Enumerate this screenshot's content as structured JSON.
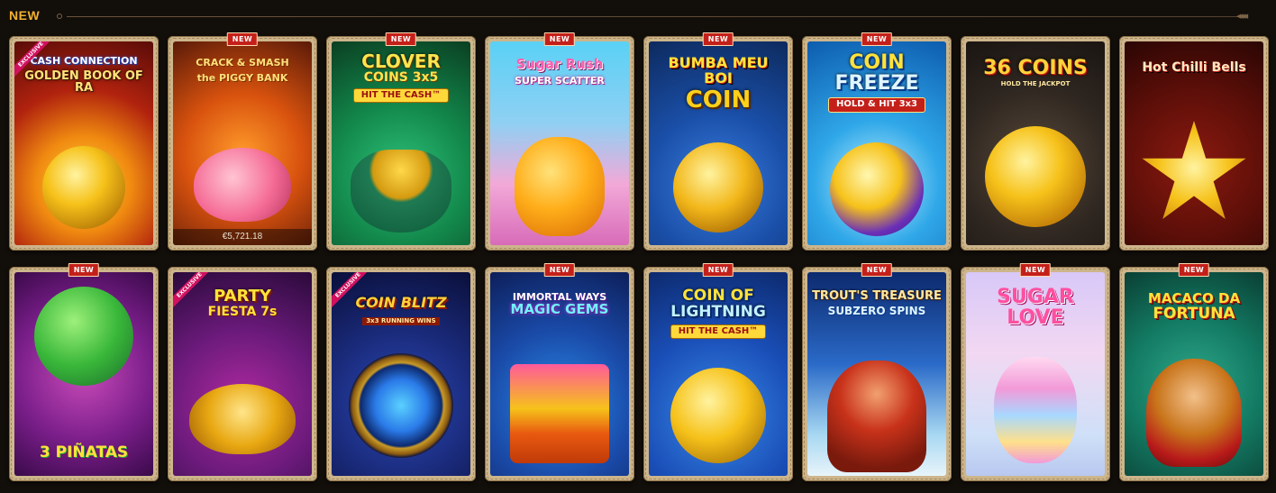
{
  "section": {
    "title": "NEW",
    "arrows": "◂◂◂◂"
  },
  "badges": {
    "new": "NEW",
    "exclusive": "EXCLUSIVE"
  },
  "games": [
    {
      "name": "CASH CONNECTION GOLDEN BOOK OF RA",
      "l1": "CASH CONNECTION",
      "l2": "GOLDEN BOOK OF RA",
      "sub": "",
      "jackpot": "",
      "new": false,
      "exclusive": true
    },
    {
      "name": "CRACK & SMASH THE PIGGY BANK",
      "l1": "CRACK & SMASH",
      "l2": "the PIGGY BANK",
      "sub": "",
      "jackpot": "€5,721.18",
      "new": true,
      "exclusive": false
    },
    {
      "name": "CLOVER COINS 3x5 HIT THE CASH",
      "l1": "CLOVER",
      "l2": "COINS 3x5",
      "sub": "HIT THE CASH™",
      "jackpot": "",
      "new": true,
      "exclusive": false
    },
    {
      "name": "Sugar Rush Super Scatter",
      "l1": "Sugar Rush",
      "l2": "SUPER SCATTER",
      "sub": "",
      "jackpot": "",
      "new": true,
      "exclusive": false
    },
    {
      "name": "BUMBA MEU BOI COIN",
      "l1": "BUMBA MEU BOI",
      "l2": "COIN",
      "sub": "",
      "jackpot": "",
      "new": true,
      "exclusive": false
    },
    {
      "name": "COIN FREEZE HOLD & HIT 3x3",
      "l1": "COIN",
      "l2": "FREEZE",
      "sub": "HOLD & HIT 3x3",
      "jackpot": "",
      "new": true,
      "exclusive": false
    },
    {
      "name": "36 COINS HOLD THE JACKPOT",
      "l1": "36 COINS",
      "l2": "HOLD THE JACKPOT",
      "sub": "",
      "jackpot": "",
      "new": false,
      "exclusive": false
    },
    {
      "name": "Hot Chilli Bells",
      "l1": "Hot Chilli Bells",
      "l2": "",
      "sub": "",
      "jackpot": "",
      "new": false,
      "exclusive": false
    },
    {
      "name": "3 PIÑATAS",
      "l1": "",
      "l2": "3 PIÑATAS",
      "sub": "",
      "jackpot": "",
      "new": true,
      "exclusive": false
    },
    {
      "name": "PARTY FIESTA 7s",
      "l1": "PARTY",
      "l2": "FIESTA 7s",
      "sub": "",
      "jackpot": "",
      "new": false,
      "exclusive": true
    },
    {
      "name": "COIN BLITZ 3x3 RUNNING WINS",
      "l1": "COIN BLITZ",
      "l2": "3x3 RUNNING WINS",
      "sub": "",
      "jackpot": "",
      "new": false,
      "exclusive": true
    },
    {
      "name": "IMMORTAL WAYS MAGIC GEMS",
      "l1": "IMMORTAL WAYS",
      "l2": "MAGIC GEMS",
      "sub": "",
      "jackpot": "",
      "new": true,
      "exclusive": false
    },
    {
      "name": "COIN OF LIGHTNING HIT THE CASH",
      "l1": "COIN OF",
      "l2": "LIGHTNING",
      "sub": "HIT THE CASH™",
      "jackpot": "",
      "new": true,
      "exclusive": false
    },
    {
      "name": "TROUT'S TREASURE SUBZERO SPINS",
      "l1": "TROUT'S TREASURE",
      "l2": "SUBZERO SPINS",
      "sub": "",
      "jackpot": "",
      "new": true,
      "exclusive": false
    },
    {
      "name": "SUGAR LOVE",
      "l1": "SUGAR",
      "l2": "LOVE",
      "sub": "",
      "jackpot": "",
      "new": true,
      "exclusive": false
    },
    {
      "name": "MACACO DA FORTUNA",
      "l1": "MACACO DA",
      "l2": "FORTUNA",
      "sub": "",
      "jackpot": "",
      "new": true,
      "exclusive": false
    }
  ],
  "colors": {
    "accent": "#f2b233",
    "badge_red": "#c4201a",
    "frame": "#cdb58c"
  }
}
